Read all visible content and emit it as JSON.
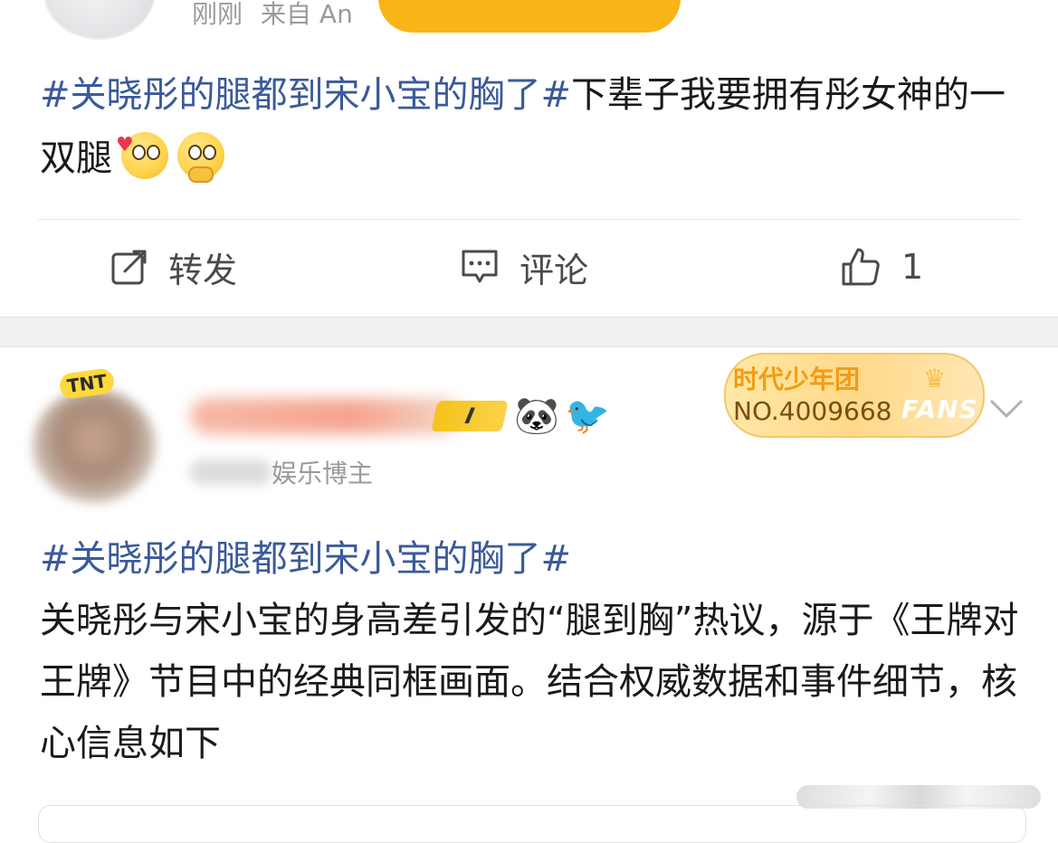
{
  "post1": {
    "time": "刚刚",
    "source": "来自 An",
    "hashtag": "#关晓彤的腿都到宋小宝的胸了#",
    "body": "下辈子我要拥有彤女神的一双腿",
    "emojis": [
      "love-face-emoji",
      "thinking-face-emoji"
    ],
    "actions": {
      "repost_label": "转发",
      "comment_label": "评论",
      "like_count": "1"
    }
  },
  "post2": {
    "avatar_badge": "TNT",
    "level_badge": "I",
    "user_subtitle": "娱乐博主",
    "fans_card": {
      "team": "时代少年团",
      "number": "NO.4009668",
      "mark": "FANS"
    },
    "hashtag": "#关晓彤的腿都到宋小宝的胸了#",
    "body": "关晓彤与宋小宝的身高差引发的“腿到胸”热议，源于《王牌对王牌》节目中的经典同框画面。结合权威数据和事件细节，核心信息如下"
  },
  "colors": {
    "hashtag": "#3a5a99",
    "toast": "#f9b417",
    "fans_team": "#f39c12",
    "level_badge": "#f6c21b"
  }
}
